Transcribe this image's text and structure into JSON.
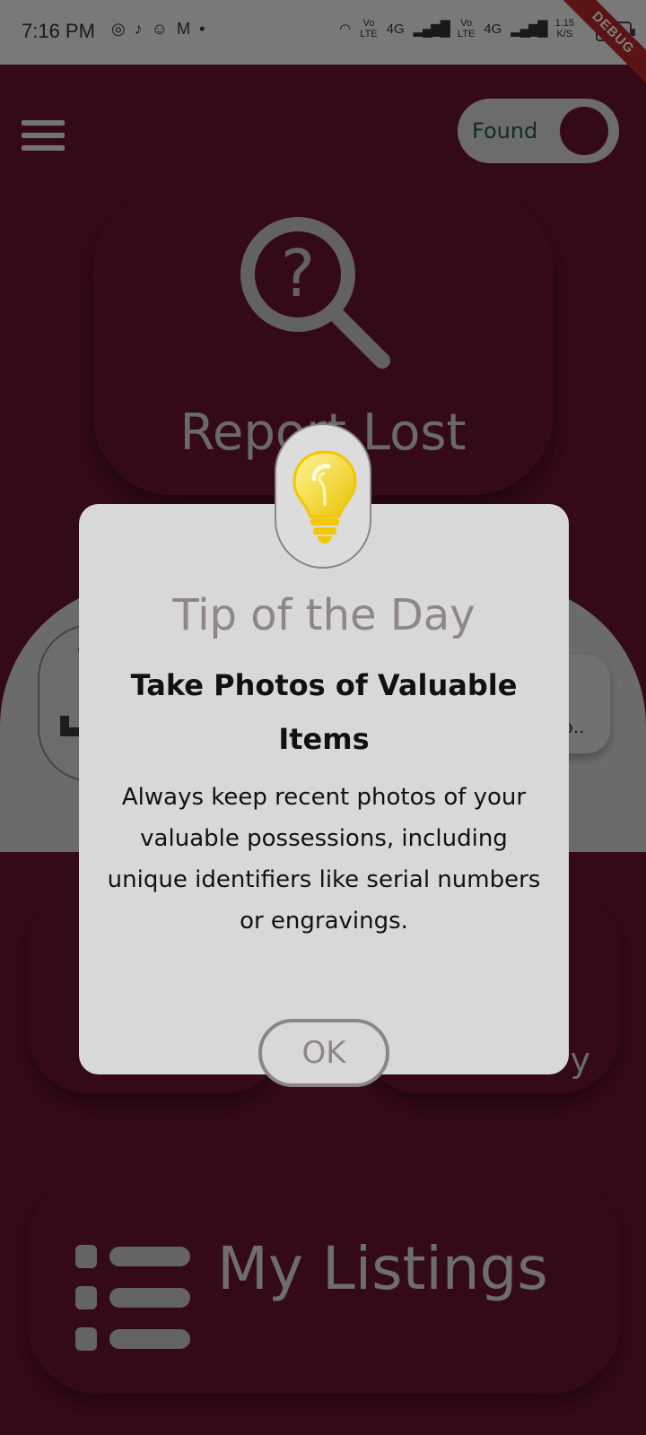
{
  "status_bar": {
    "time": "7:16 PM",
    "left_icons": [
      "game-icon",
      "bell-icon",
      "snapchat-icon",
      "gmail-icon",
      "dot-icon"
    ],
    "sim1_top": "Vo",
    "sim1_bottom": "LTE",
    "sim1_net": "4G",
    "sim2_top": "Vo",
    "sim2_bottom": "LTE",
    "sim2_net": "4G",
    "speed_value": "1.15",
    "speed_unit": "K/S",
    "debug_label": "DEBUG"
  },
  "header": {
    "toggle_label": "Found"
  },
  "report_card": {
    "label": "Report Lost"
  },
  "tips": {
    "right_tile_text": "ap.."
  },
  "action_card_right": {
    "label": "y"
  },
  "listings_card": {
    "label": "My Listings"
  },
  "dialog": {
    "title": "Tip of the Day",
    "heading": "Take Photos of Valuable Items",
    "body": "Always keep recent photos of your valuable possessions, including unique identifiers like serial numbers or engravings.",
    "ok_label": "OK"
  },
  "colors": {
    "primary": "#6b1531",
    "surface": "#d8d8d8",
    "bulb": "#f4d000",
    "accent_text": "#8f8787"
  }
}
